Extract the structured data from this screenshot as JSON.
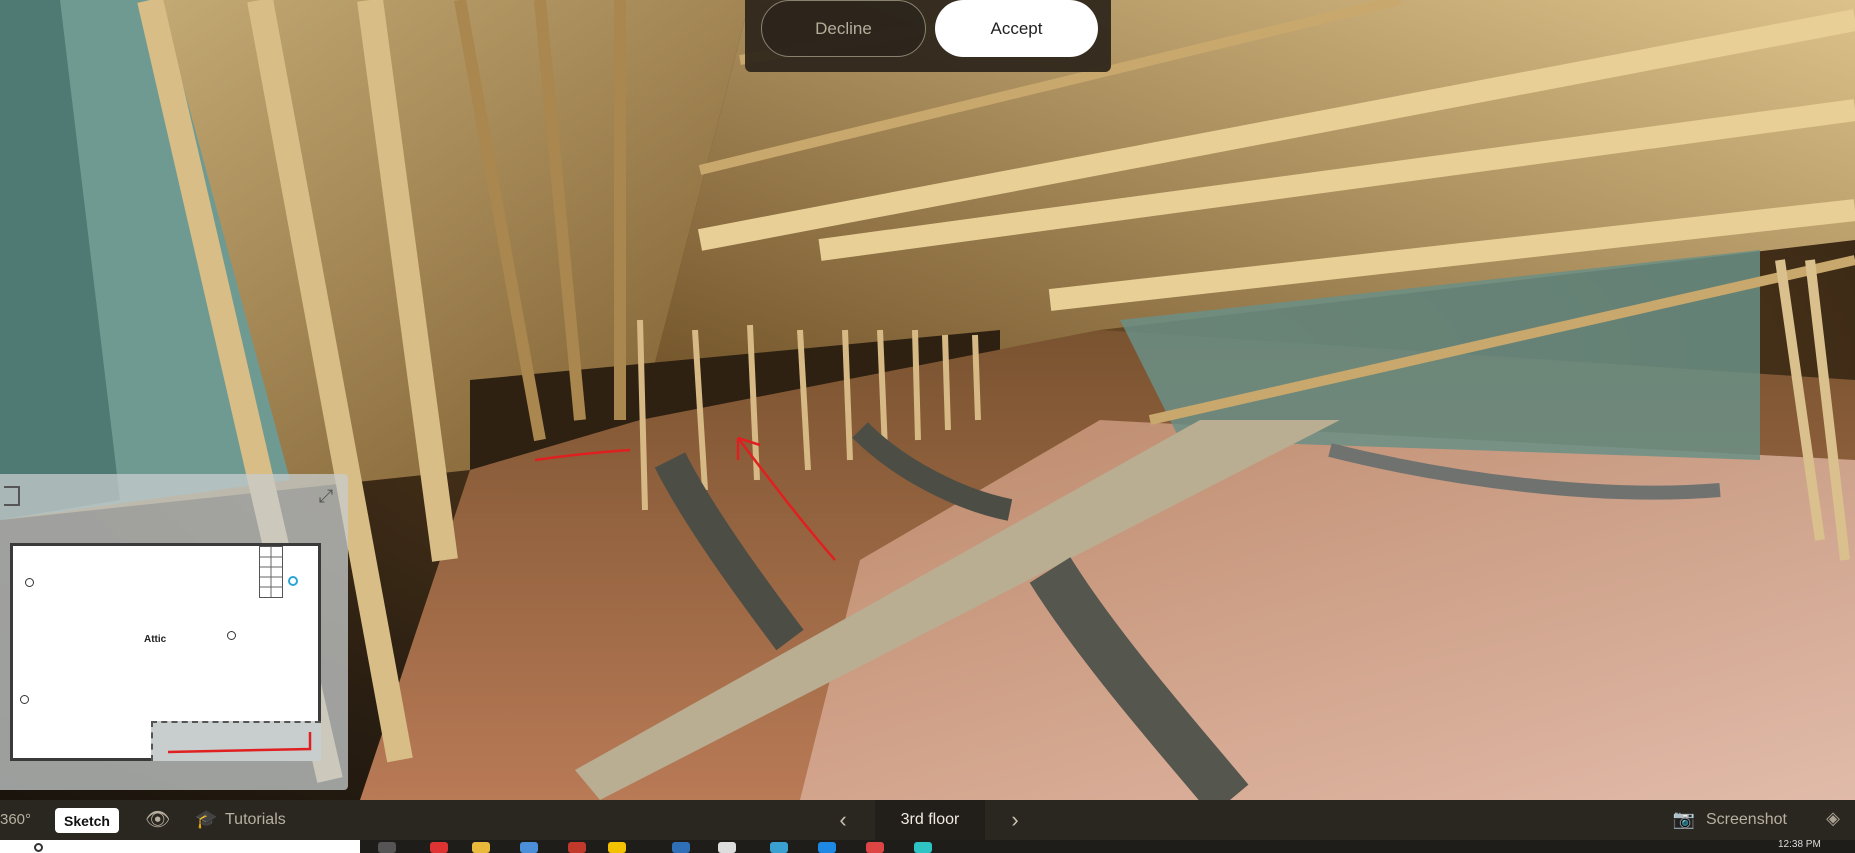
{
  "consent": {
    "decline_label": "Decline",
    "accept_label": "Accept"
  },
  "minimap": {
    "room_label": "Attic"
  },
  "toolbar": {
    "view_mode": "360°",
    "sketch_label": "Sketch",
    "tutorials_label": "Tutorials",
    "floor_label": "3rd floor",
    "screenshot_label": "Screenshot",
    "icons": {
      "eye": "eye-icon",
      "tutorials": "graduation-cap-icon",
      "camera": "camera-icon",
      "layers": "layers-icon"
    }
  },
  "taskbar": {
    "clock": "12:38 PM"
  },
  "colors": {
    "annotation": "#e02020",
    "current_position": "#2aa6d6"
  }
}
